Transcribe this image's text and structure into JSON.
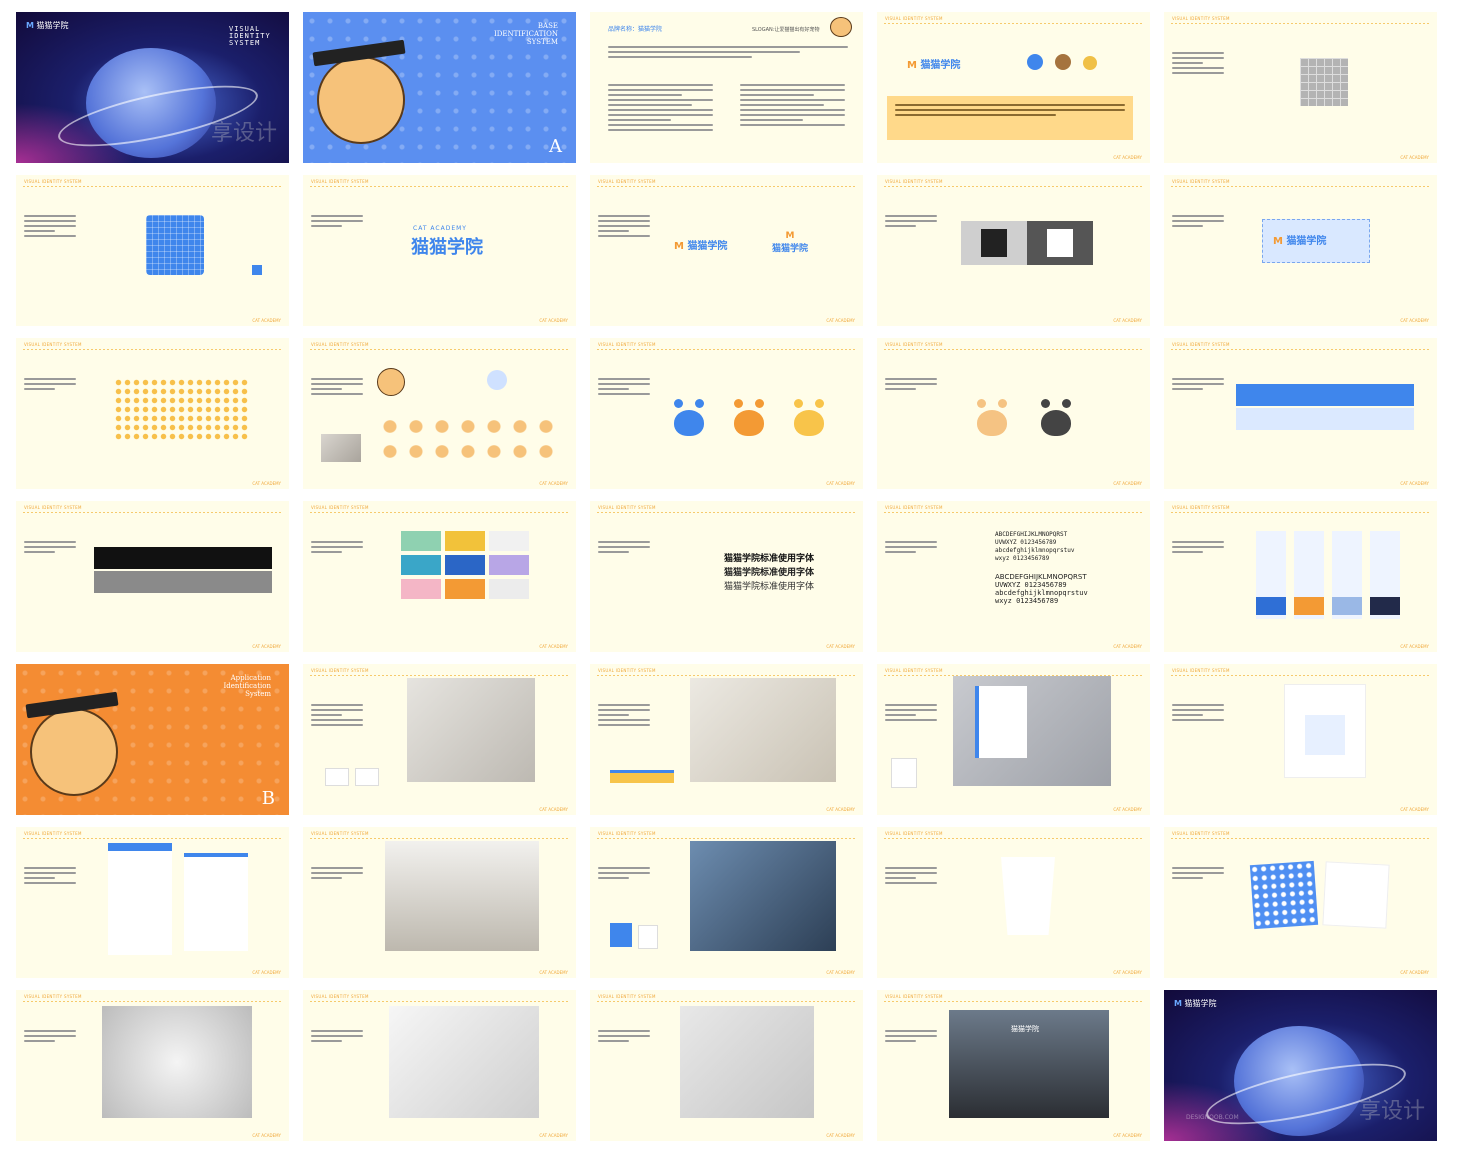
{
  "brand": {
    "name_cn": "猫猫学院",
    "name_en": "CAT ACADEMY",
    "header_label": "VISUAL IDENTITY SYSTEM",
    "footer_label": "CAT ACADEMY",
    "watermark": "享设计",
    "watermark_en": "DESIGNOOB.COM"
  },
  "cover": {
    "title": "VISUAL IDENTITY SYSTEM"
  },
  "section_a": {
    "title_lines": [
      "BASE",
      "IDENTIFICATION",
      "SYSTEM"
    ],
    "letter": "A"
  },
  "section_b": {
    "title_lines": [
      "Application",
      "Identification",
      "System"
    ],
    "letter": "B"
  },
  "brand_intro": {
    "name_label": "品牌名称：猫猫学院",
    "slogan_label": "SLOGAN:让爱猫猫出有好宠物"
  },
  "fonts": {
    "sample_lines": [
      "猫猫学院标准使用字体",
      "猫猫学院标准使用字体",
      "猫猫学院标准使用字体"
    ],
    "latin_upper": "ABCDEFGHIJKLMNOPQRST",
    "latin_upper2": "UVWXYZ 0123456789",
    "latin_lower": "abcdefghijklmnopqrstuv",
    "latin_lower2": "wxyz 0123456789"
  },
  "colors": {
    "blue": "#3f86ec",
    "orange": "#f39a34",
    "yellow": "#f8c44a",
    "dark": "#3c3c3c",
    "cream": "#fffde9"
  }
}
